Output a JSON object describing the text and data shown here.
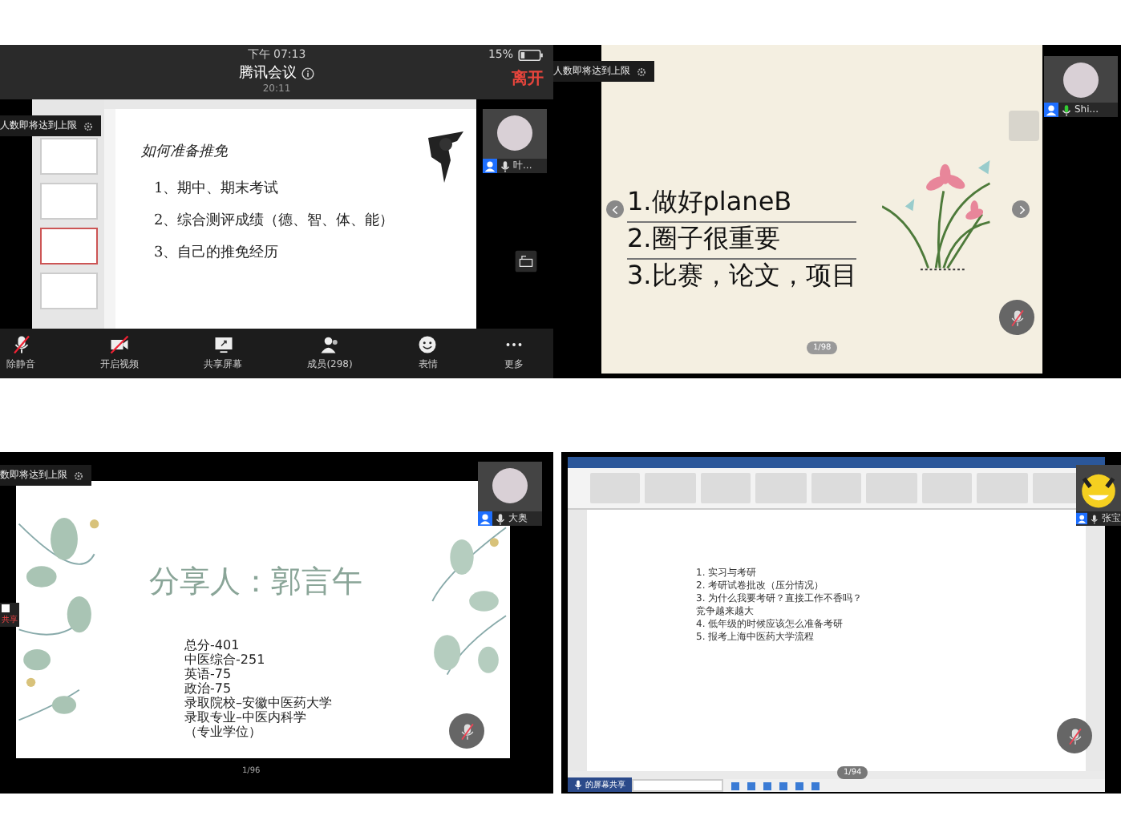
{
  "meeting_phone": {
    "status_time": "下午 07:13",
    "title": "腾讯会议",
    "duration": "20:11",
    "battery": "15%",
    "leave": "离开",
    "notice": "人数即将达到上限",
    "participant": {
      "name": "叶..."
    },
    "slide": {
      "title": "如何准备推免",
      "items": [
        "1、期中、期末考试",
        "2、综合测评成绩（德、智、体、能）",
        "3、自己的推免经历"
      ]
    },
    "toolbar": [
      {
        "kind": "mic_off",
        "label": "除静音"
      },
      {
        "kind": "video_off",
        "label": "开启视频"
      },
      {
        "kind": "share",
        "label": "共享屏幕"
      },
      {
        "kind": "members",
        "label": "成员(298)"
      },
      {
        "kind": "emoji",
        "label": "表情"
      },
      {
        "kind": "more",
        "label": "更多"
      }
    ]
  },
  "meeting_slides": {
    "notice": "人数即将达到上限",
    "participant": {
      "name": "Shi..."
    },
    "lines": [
      "1.做好planeB",
      "2.圈子很重要",
      "3.比赛，论文，项目"
    ],
    "page": "1/98"
  },
  "meeting_cover": {
    "notice": "数即将达到上限",
    "participant": {
      "name": "大奥"
    },
    "side_label": "共享",
    "title": "分享人：郭言午",
    "lines": [
      "总分-401",
      "中医综合-251",
      "英语-75",
      "政治-75",
      "录取院校–安徽中医药大学",
      "录取专业–中医内科学",
      "（专业学位）"
    ],
    "page": "1/96"
  },
  "meeting_word": {
    "participant": {
      "name": "张宝"
    },
    "lines": [
      "1.  实习与考研",
      "2.  考研试卷批改（压分情况）",
      "3.  为什么我要考研？直接工作不香吗？",
      "竞争越来越大",
      "4.  低年级的时候应该怎么准备考研",
      "5.  报考上海中医药大学流程"
    ],
    "share_label": "的屏幕共享",
    "page": "1/94"
  }
}
